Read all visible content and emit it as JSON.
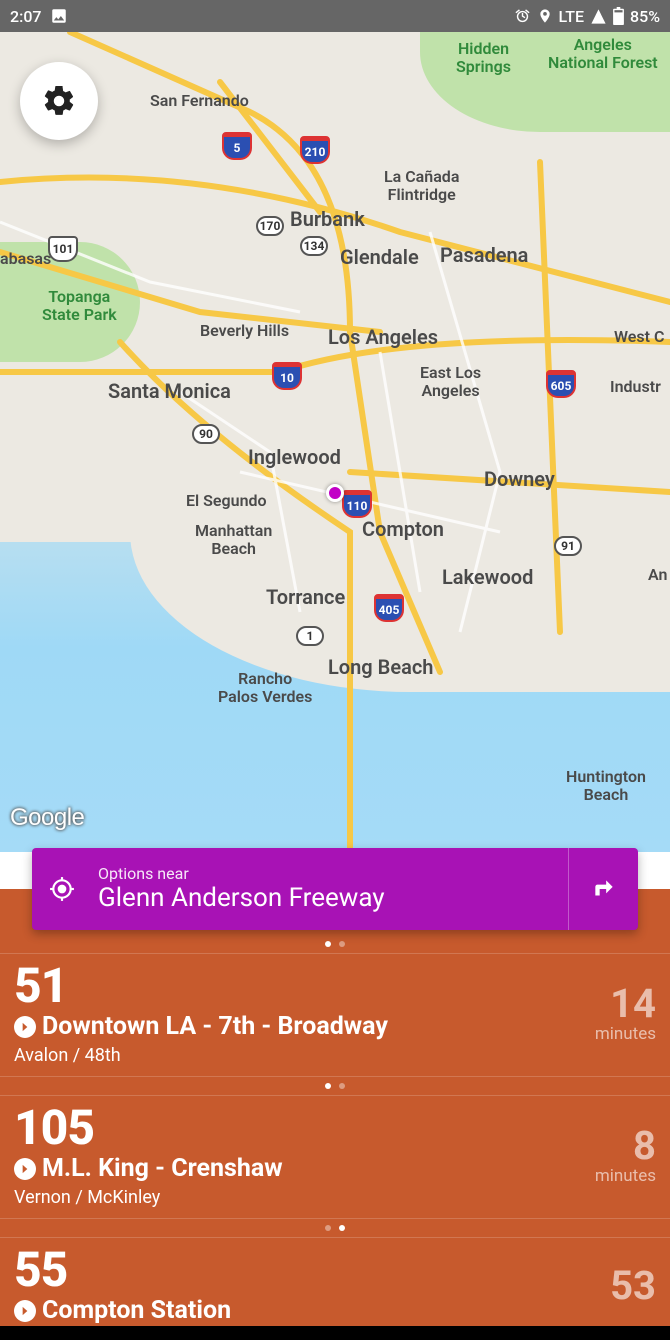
{
  "status": {
    "time": "2:07",
    "network": "LTE",
    "battery": "85%"
  },
  "map": {
    "attribution": "Google",
    "labels": {
      "hidden_springs": "Hidden\nSprings",
      "angeles_nf": "Angeles\nNational Forest",
      "san_fernando": "San Fernando",
      "la_canada": "La Cañada\nFlintridge",
      "burbank": "Burbank",
      "glendale": "Glendale",
      "pasadena": "Pasadena",
      "topanga": "Topanga\nState Park",
      "beverly_hills": "Beverly Hills",
      "los_angeles": "Los Angeles",
      "west_c": "West C",
      "santa_monica": "Santa Monica",
      "east_la": "East Los\nAngeles",
      "industr": "Industr",
      "inglewood": "Inglewood",
      "downey": "Downey",
      "el_segundo": "El Segundo",
      "compton": "Compton",
      "manhattan_beach": "Manhattan\nBeach",
      "lakewood": "Lakewood",
      "an": "An",
      "torrance": "Torrance",
      "long_beach": "Long Beach",
      "rancho_pv": "Rancho\nPalos Verdes",
      "huntington_beach": "Huntington\nBeach",
      "abasas": "abasas"
    },
    "shields": {
      "i5": "5",
      "i210": "210",
      "us101": "101",
      "sr170": "170",
      "sr134": "134",
      "i10": "10",
      "i605": "605",
      "sr90": "90",
      "i110": "110",
      "sr91": "91",
      "i405": "405",
      "sr1": "1"
    }
  },
  "search": {
    "label": "Options near",
    "value": "Glenn Anderson Freeway"
  },
  "routes": [
    {
      "number": "51",
      "destination": "Downtown LA - 7th - Broadway",
      "stop": "Avalon / 48th",
      "eta": "14",
      "unit": "minutes"
    },
    {
      "number": "105",
      "destination": "M.L. King - Crenshaw",
      "stop": "Vernon / McKinley",
      "eta": "8",
      "unit": "minutes"
    },
    {
      "number": "55",
      "destination": "Compton Station",
      "stop": "",
      "eta": "53",
      "unit": ""
    }
  ]
}
